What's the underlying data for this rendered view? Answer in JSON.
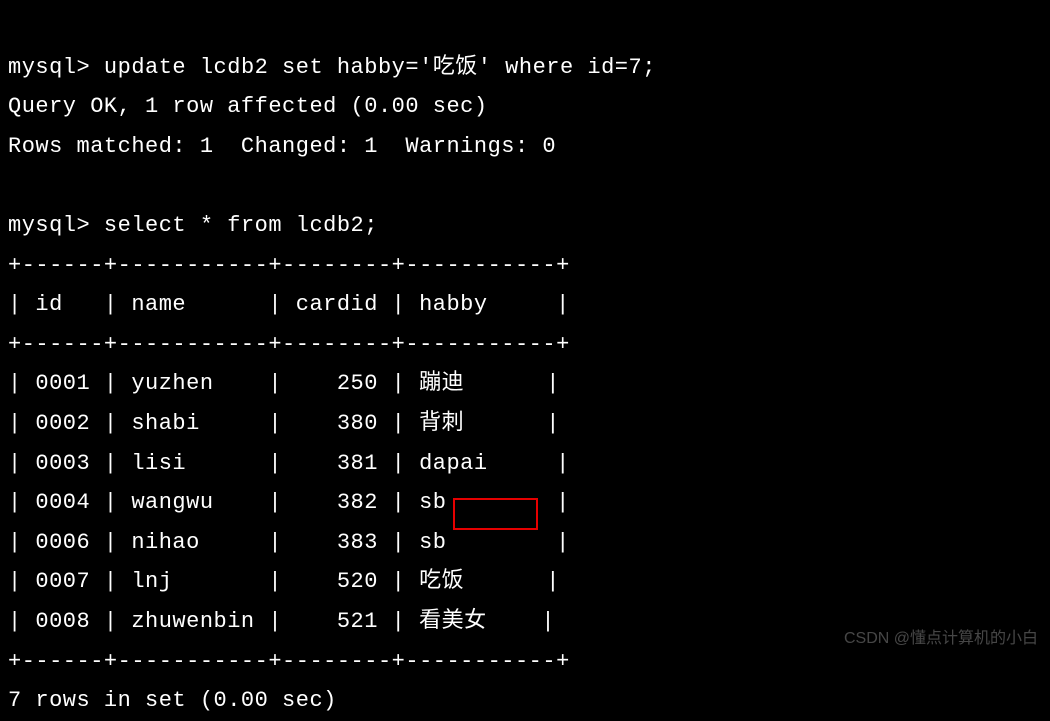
{
  "prompt_label": "mysql>",
  "commands": {
    "update_cmd": "update lcdb2 set habby='吃饭' where id=7;",
    "update_result_line1": "Query OK, 1 row affected (0.00 sec)",
    "update_result_line2": "Rows matched: 1  Changed: 1  Warnings: 0",
    "select_cmd": "select * from lcdb2;"
  },
  "table": {
    "border_top": "+------+-----------+--------+-----------+",
    "header_line": "| id   | name      | cardid | habby     |",
    "border_mid": "+------+-----------+--------+-----------+",
    "columns": [
      "id",
      "name",
      "cardid",
      "habby"
    ],
    "rows": [
      {
        "id": "0001",
        "name": "yuzhen",
        "cardid": "250",
        "habby": "蹦迪",
        "line": "| 0001 | yuzhen    |    250 | 蹦迪      |"
      },
      {
        "id": "0002",
        "name": "shabi",
        "cardid": "380",
        "habby": "背刺",
        "line": "| 0002 | shabi     |    380 | 背刺      |"
      },
      {
        "id": "0003",
        "name": "lisi",
        "cardid": "381",
        "habby": "dapai",
        "line": "| 0003 | lisi      |    381 | dapai     |"
      },
      {
        "id": "0004",
        "name": "wangwu",
        "cardid": "382",
        "habby": "sb",
        "line": "| 0004 | wangwu    |    382 | sb        |"
      },
      {
        "id": "0006",
        "name": "nihao",
        "cardid": "383",
        "habby": "sb",
        "line": "| 0006 | nihao     |    383 | sb        |"
      },
      {
        "id": "0007",
        "name": "lnj",
        "cardid": "520",
        "habby": "吃饭",
        "line": "| 0007 | lnj       |    520 | 吃饭      |"
      },
      {
        "id": "0008",
        "name": "zhuwenbin",
        "cardid": "521",
        "habby": "看美女",
        "line": "| 0008 | zhuwenbin |    521 | 看美女    |"
      }
    ],
    "border_bot": "+------+-----------+--------+-----------+",
    "footer": "7 rows in set (0.00 sec)"
  },
  "highlight": {
    "target_value": "吃饭",
    "row_index": 5
  },
  "watermark": "CSDN @懂点计算机的小白"
}
